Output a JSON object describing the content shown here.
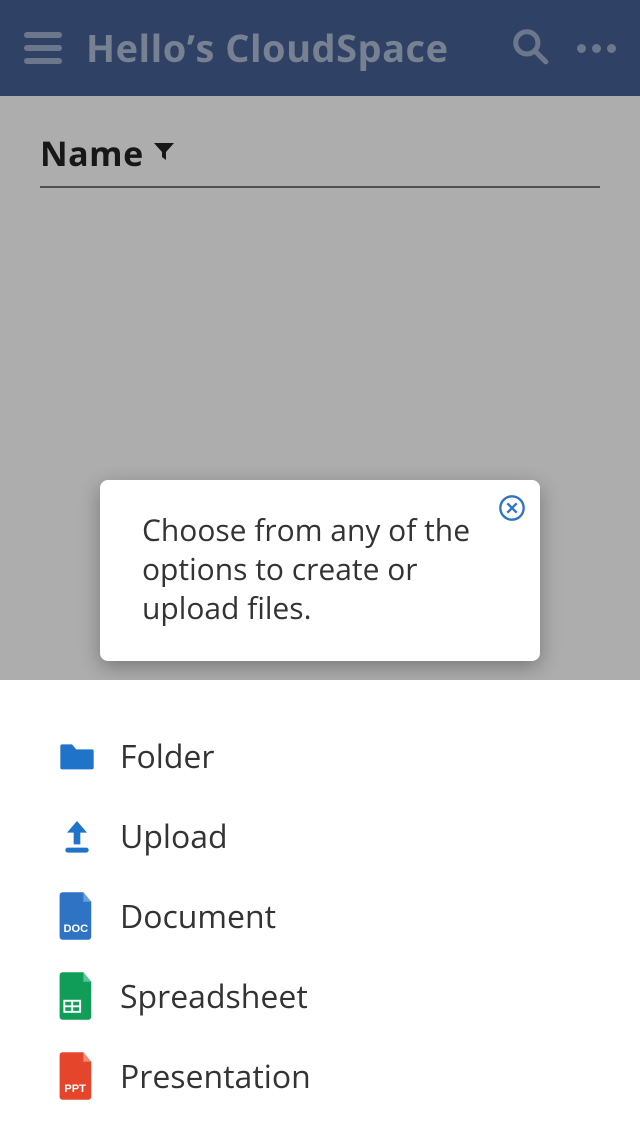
{
  "header": {
    "title": "Hello’s CloudSpace"
  },
  "list": {
    "column_label": "Name"
  },
  "coach": {
    "text": "Choose from any of the options to create or upload files."
  },
  "sheet": {
    "options": [
      {
        "label": "Folder"
      },
      {
        "label": "Upload"
      },
      {
        "label": "Document"
      },
      {
        "label": "Spreadsheet"
      },
      {
        "label": "Presentation"
      }
    ]
  },
  "icons": {
    "doc_badge": "DOC",
    "ppt_badge": "PPT"
  },
  "colors": {
    "header": "#466296",
    "folder": "#1f73c9",
    "upload": "#1f73c9",
    "doc": "#2f74c4",
    "sheet": "#0f9d58",
    "ppt": "#e5452a",
    "close": "#2f74c4"
  }
}
